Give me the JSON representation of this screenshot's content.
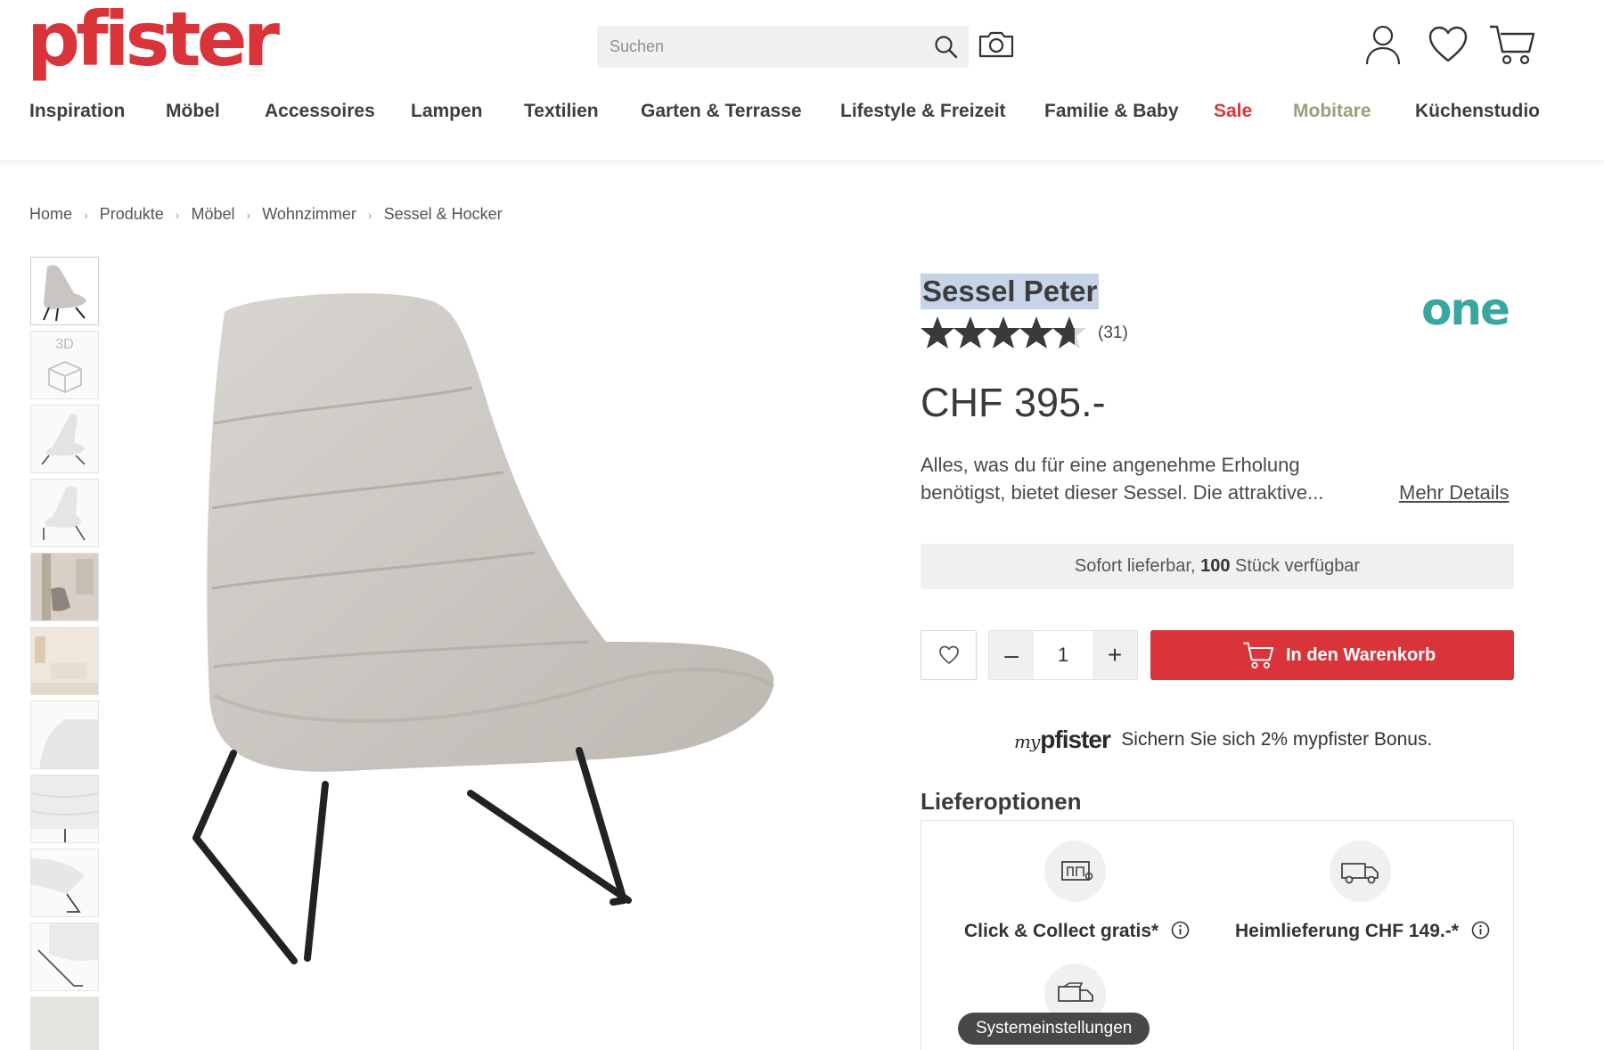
{
  "header": {
    "logo": "pfister",
    "search_placeholder": "Suchen",
    "nav": [
      {
        "label": "Inspiration"
      },
      {
        "label": "Möbel"
      },
      {
        "label": "Accessoires"
      },
      {
        "label": "Lampen"
      },
      {
        "label": "Textilien"
      },
      {
        "label": "Garten & Terrasse"
      },
      {
        "label": "Lifestyle & Freizeit"
      },
      {
        "label": "Familie & Baby"
      },
      {
        "label": "Sale"
      },
      {
        "label": "Mobitare"
      },
      {
        "label": "Küchenstudio"
      }
    ]
  },
  "breadcrumb": [
    "Home",
    "Produkte",
    "Möbel",
    "Wohnzimmer",
    "Sessel & Hocker"
  ],
  "gallery": {
    "thumb_3d_label": "3D"
  },
  "product": {
    "title": "Sessel Peter",
    "brand": "one",
    "rating": 4.5,
    "review_count": "(31)",
    "price": "CHF 395.-",
    "description": "Alles, was du für eine angenehme Erholung benötigst, bietet dieser Sessel. Die attraktive...",
    "more_details": "Mehr Details",
    "availability_prefix": "Sofort lieferbar, ",
    "availability_count": "100",
    "availability_suffix": " Stück verfügbar",
    "quantity": "1",
    "qty_minus": "–",
    "qty_plus": "+",
    "add_to_cart": "In den Warenkorb"
  },
  "bonus": {
    "logo_my": "my",
    "logo_pfister": "pfister",
    "text": "Sichern Sie sich 2% mypfister Bonus."
  },
  "delivery": {
    "title": "Lieferoptionen",
    "options": [
      {
        "label": "Click & Collect gratis*"
      },
      {
        "label": "Heimlieferung CHF 149.-*"
      }
    ]
  },
  "tooltip": "Systemeinstellungen",
  "colors": {
    "brand_red": "#d9343a",
    "mobitare": "#98a07a",
    "brand_one": "#3aa6a0",
    "selection": "#c7d3e6"
  }
}
